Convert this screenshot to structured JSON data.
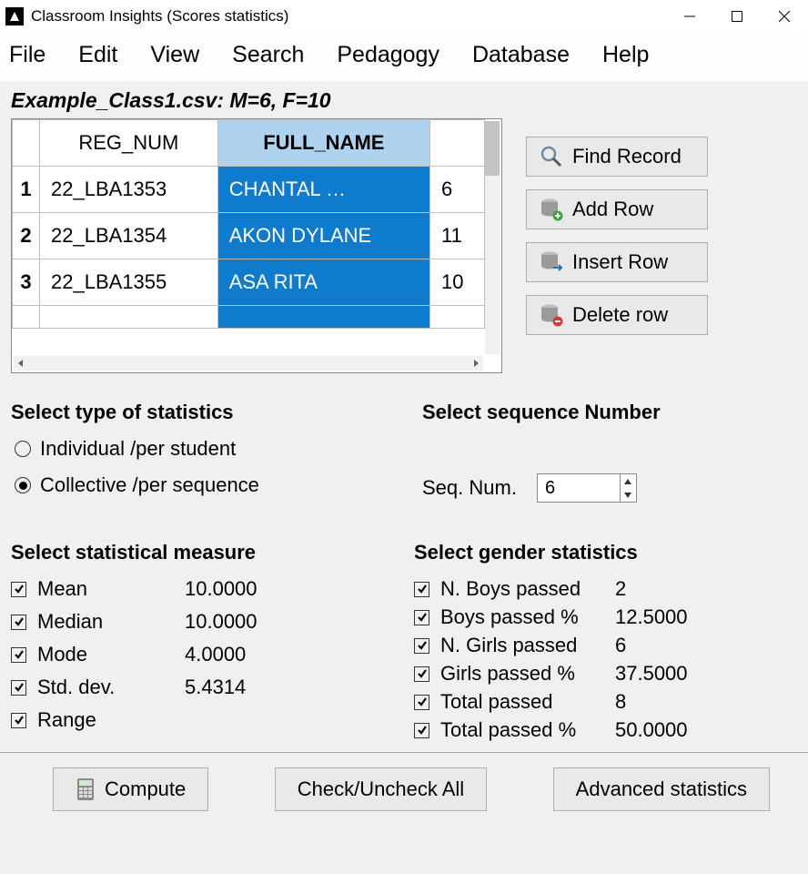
{
  "window": {
    "title": "Classroom Insights (Scores statistics)"
  },
  "menu": {
    "items": [
      "File",
      "Edit",
      "View",
      "Search",
      "Pedagogy",
      "Database",
      "Help"
    ]
  },
  "file_label": "Example_Class1.csv: M=6, F=10",
  "table": {
    "headers": [
      "REG_NUM",
      "FULL_NAME",
      ""
    ],
    "rows": [
      {
        "idx": "1",
        "reg": "22_LBA1353",
        "name": "CHANTAL …",
        "score": "6"
      },
      {
        "idx": "2",
        "reg": "22_LBA1354",
        "name": "AKON DYLANE",
        "score": "11"
      },
      {
        "idx": "3",
        "reg": "22_LBA1355",
        "name": "ASA RITA",
        "score": "10"
      }
    ]
  },
  "side_buttons": {
    "find": "Find Record",
    "add": "Add Row",
    "insert": "Insert Row",
    "delete": "Delete row"
  },
  "type_stats": {
    "title": "Select type of statistics",
    "opt1": "Individual /per student",
    "opt2": "Collective /per sequence"
  },
  "seq": {
    "title": "Select sequence Number",
    "label": "Seq. Num.",
    "value": "6"
  },
  "measures": {
    "title": "Select statistical measure",
    "rows": [
      {
        "label": "Mean",
        "value": "10.0000"
      },
      {
        "label": "Median",
        "value": "10.0000"
      },
      {
        "label": "Mode",
        "value": "4.0000"
      },
      {
        "label": "Std. dev.",
        "value": "5.4314"
      },
      {
        "label": "Range",
        "value": ""
      }
    ]
  },
  "gender": {
    "title": "Select gender statistics",
    "rows": [
      {
        "label": "N. Boys passed",
        "value": "2"
      },
      {
        "label": "Boys passed %",
        "value": "12.5000"
      },
      {
        "label": "N. Girls passed",
        "value": "6"
      },
      {
        "label": "Girls passed %",
        "value": "37.5000"
      },
      {
        "label": "Total passed",
        "value": "8"
      },
      {
        "label": "Total passed %",
        "value": "50.0000"
      }
    ]
  },
  "bottom": {
    "compute": "Compute",
    "check": "Check/Uncheck All",
    "adv": "Advanced statistics"
  }
}
